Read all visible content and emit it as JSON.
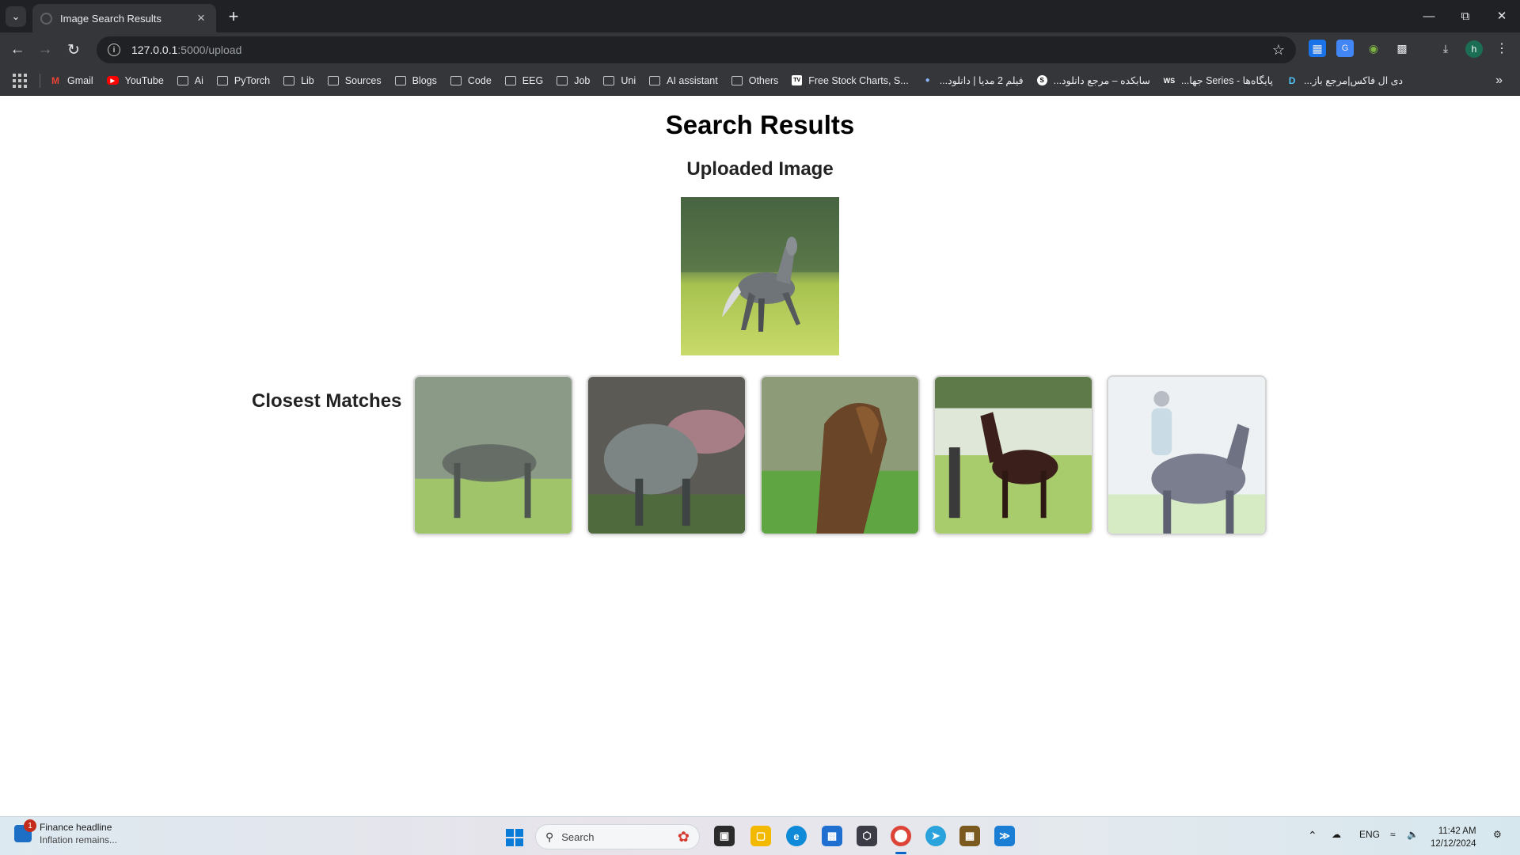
{
  "browser": {
    "tab_title": "Image Search Results",
    "url_host": "127.0.0.1",
    "url_path": ":5000/upload",
    "profile_initial": "h",
    "bookmarks": [
      {
        "label": "Gmail",
        "icon": "gmail-icon"
      },
      {
        "label": "YouTube",
        "icon": "youtube-icon"
      },
      {
        "label": "Ai",
        "icon": "folder-icon"
      },
      {
        "label": "PyTorch",
        "icon": "folder-icon"
      },
      {
        "label": "Lib",
        "icon": "folder-icon"
      },
      {
        "label": "Sources",
        "icon": "folder-icon"
      },
      {
        "label": "Blogs",
        "icon": "folder-icon"
      },
      {
        "label": "Code",
        "icon": "folder-icon"
      },
      {
        "label": "EEG",
        "icon": "folder-icon"
      },
      {
        "label": "Job",
        "icon": "folder-icon"
      },
      {
        "label": "Uni",
        "icon": "folder-icon"
      },
      {
        "label": "AI assistant",
        "icon": "folder-icon"
      },
      {
        "label": "Others",
        "icon": "folder-icon"
      },
      {
        "label": "Free Stock Charts, S...",
        "icon": "tradingview-icon"
      },
      {
        "label": "فیلم 2 مدیا | دانلود...",
        "icon": "dot-icon"
      },
      {
        "label": "سابکده – مرجع دانلود...",
        "icon": "subkade-icon"
      },
      {
        "label": "پایگاه‌ها - Series جها...",
        "icon": "ws-icon"
      },
      {
        "label": "دی ال فاکس|مرجع باز...",
        "icon": "dlfox-icon"
      }
    ]
  },
  "page": {
    "title": "Search Results",
    "uploaded_heading": "Uploaded Image",
    "matches_heading": "Closest Matches",
    "matches": [
      {
        "label": "match 1"
      },
      {
        "label": "match 2"
      },
      {
        "label": "match 3"
      },
      {
        "label": "match 4"
      },
      {
        "label": "match 5"
      }
    ]
  },
  "taskbar": {
    "news_badge": "1",
    "news_title": "Finance headline",
    "news_subtitle": "Inflation remains...",
    "search_placeholder": "Search",
    "language": "ENG",
    "time": "11:42 AM",
    "date": "12/12/2024"
  },
  "colors": {
    "chrome_dark": "#202124",
    "chrome_toolbar": "#35363a",
    "windows_accent": "#0a7cd8"
  }
}
